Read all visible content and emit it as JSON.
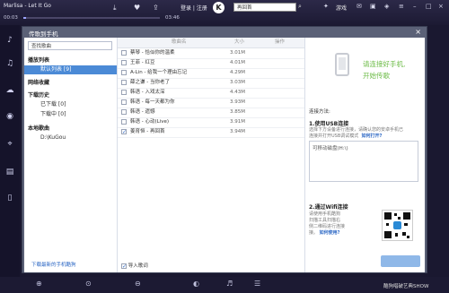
{
  "player": {
    "song_title": "Marlisa - Let It Go",
    "time_current": "00:03",
    "time_total": "03:46",
    "progress": 0.02,
    "login_label": "登录 | 注册",
    "logo_text": "K",
    "search_value": "再回首",
    "game_label": "游戏"
  },
  "dialog": {
    "title": "传歌到手机",
    "left": {
      "search_placeholder": "查找歌曲",
      "cat_playlist": "播放列表",
      "item_default_list": "默认列表 [9]",
      "cat_net": "网络收藏",
      "cat_download": "下载历史",
      "item_downloaded": "已下载 [0]",
      "item_downloading": "下载中 [0]",
      "cat_local": "本地歌曲",
      "item_local_path": "D:\\KuGou",
      "footer_link": "下载最新的手机酷狗"
    },
    "middle": {
      "col_name": "歌曲名",
      "col_size": "大小",
      "col_action": "操作",
      "songs": [
        {
          "name": "蔡琴 - 恰似你的温柔",
          "size": "3.01M",
          "checked": false
        },
        {
          "name": "王菲 - 红豆",
          "size": "4.01M",
          "checked": false
        },
        {
          "name": "A-Lin - 给我一个理由忘记",
          "size": "4.29M",
          "checked": false
        },
        {
          "name": "薛之谦 - 当你老了",
          "size": "3.03M",
          "checked": false
        },
        {
          "name": "韩语 - 入戏太深",
          "size": "4.43M",
          "checked": false
        },
        {
          "name": "韩语 - 每一天都为你",
          "size": "3.93M",
          "checked": false
        },
        {
          "name": "韩语 - 遗憾",
          "size": "3.85M",
          "checked": false
        },
        {
          "name": "韩语 - 心动(Live)",
          "size": "3.91M",
          "checked": false
        },
        {
          "name": "姜育恒 - 再回首",
          "size": "3.94M",
          "checked": true
        }
      ],
      "footer_checkbox": "导入歌词"
    },
    "right": {
      "tip_line1": "请连接好手机,",
      "tip_line2": "开始传歌",
      "connect_way": "连接方法:",
      "usb_title": "1.使用USB连接",
      "usb_desc1": "选择下方设备进行连接，请确认您的安卓手机已",
      "usb_desc2": "连接并打开USB调试模式",
      "usb_help": "如何打开?",
      "drive_label": "可移动磁盘(H:\\)",
      "wifi_title": "2.通过Wifi连接",
      "wifi_desc1": "请使用手机酷狗",
      "wifi_desc2": "扫描工具扫描右",
      "wifi_desc3": "侧二维码进行连接",
      "wifi_desc4": "接。",
      "wifi_help": "如何使用?"
    }
  },
  "status": {
    "text": "酷狗唱破艺典SHOW"
  }
}
